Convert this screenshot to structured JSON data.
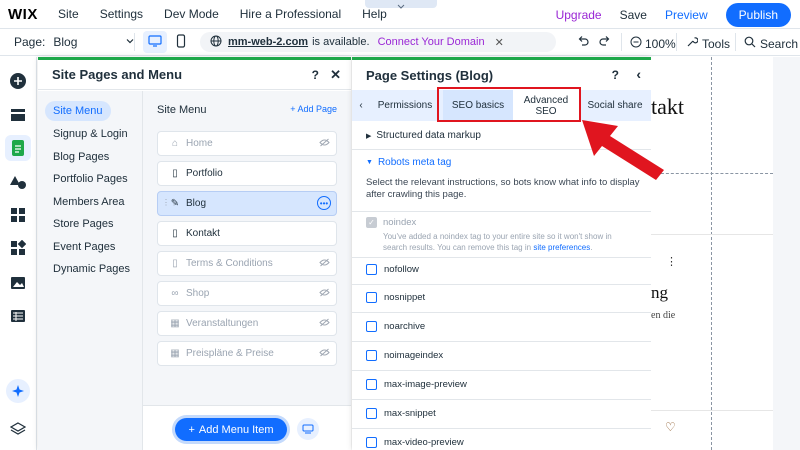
{
  "app": {
    "logo": "WIX",
    "menu": [
      "Site",
      "Settings",
      "Dev Mode",
      "Hire a Professional",
      "Help"
    ],
    "upgrade": "Upgrade",
    "save": "Save",
    "preview": "Preview",
    "publish": "Publish"
  },
  "toolbar": {
    "page_label": "Page:",
    "page_value": "Blog",
    "domain": "mm-web-2.com",
    "domain_status": "is available.",
    "connect": "Connect Your Domain",
    "zoom": "100%",
    "tools": "Tools",
    "search": "Search"
  },
  "pages_panel": {
    "title": "Site Pages and Menu",
    "categories": [
      "Site Menu",
      "Signup & Login",
      "Blog Pages",
      "Portfolio Pages",
      "Members Area",
      "Store Pages",
      "Event Pages",
      "Dynamic Pages"
    ],
    "menu_title": "Site Menu",
    "add_page": "+ Add Page",
    "pages": [
      "Home",
      "Portfolio",
      "Blog",
      "Kontakt",
      "Terms & Conditions",
      "Shop",
      "Veranstaltungen",
      "Preispläne & Preise"
    ],
    "add_menu_item": "Add Menu Item"
  },
  "settings_panel": {
    "title": "Page Settings (Blog)",
    "tabs": [
      "Permissions",
      "SEO basics",
      "Advanced SEO",
      "Social share"
    ],
    "structured_data": "Structured data markup",
    "robots": "Robots meta tag",
    "instructions": "Select the relevant instructions, so bots know what info to display after crawling this page.",
    "noindex": "noindex",
    "noindex_note": "You've added a noindex tag to your entire site so it won't show in search results. You can remove this tag in",
    "noindex_link": "site preferences",
    "options": [
      "nofollow",
      "nosnippet",
      "noarchive",
      "noimageindex",
      "max-image-preview",
      "max-snippet",
      "max-video-preview"
    ]
  },
  "canvas": {
    "heading": "takt",
    "heading2": "ng",
    "text": "en die"
  },
  "colors": {
    "accent": "#116dff",
    "upgrade": "#9a27d5",
    "panel_border": "#1ea84a",
    "annotation": "#e0151f"
  }
}
